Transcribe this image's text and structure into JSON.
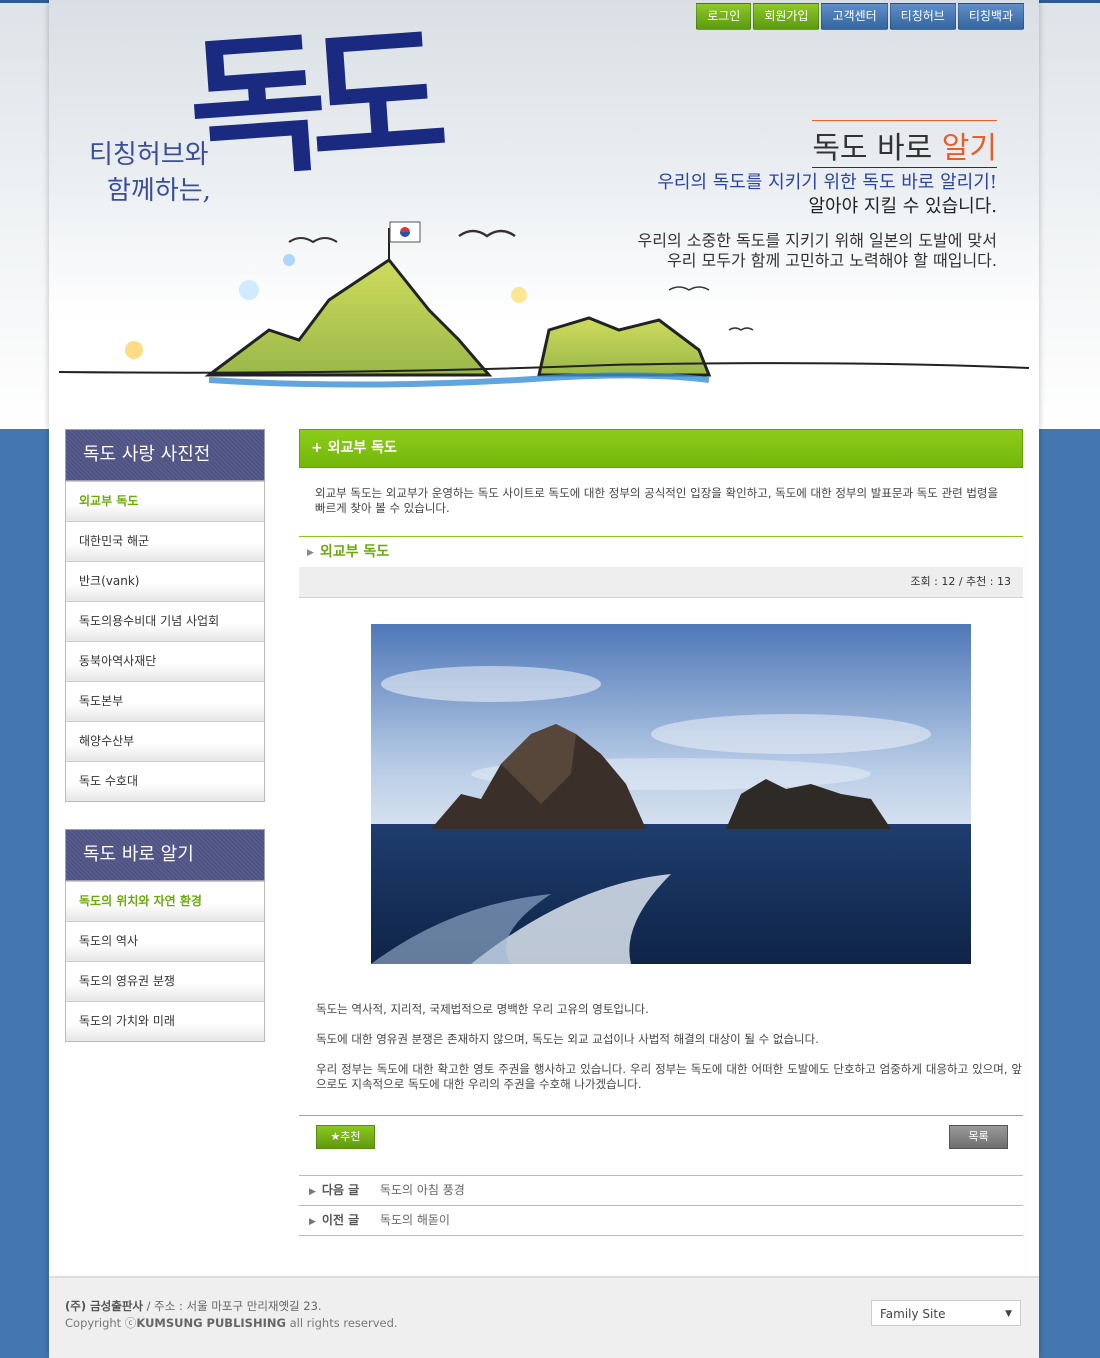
{
  "top_menu": [
    {
      "label": "로그인"
    },
    {
      "label": "회원가입"
    },
    {
      "label": "고객센터"
    },
    {
      "label": "티칭허브"
    },
    {
      "label": "티칭백과"
    }
  ],
  "header": {
    "logo_big": "독도",
    "logo_sub1": "티칭허브와",
    "logo_sub2": "함께하는,",
    "right_title_a": "독도 바로 ",
    "right_title_b": "알기",
    "line1": "우리의 독도를 지키기 위한 독도 바로 알리기!",
    "line2": "알아야 지킬 수 있습니다.",
    "line3": "우리의 소중한 독도를 지키기 위해 일본의 도발에 맞서",
    "line4": "우리 모두가 함께 고민하고 노력해야 할 때입니다."
  },
  "sidebar1": {
    "title": "독도 사랑 사진전",
    "items": [
      "외교부 독도",
      "대한민국 해군",
      "반크(vank)",
      "독도의용수비대 기념 사업회",
      "동북아역사재단",
      "독도본부",
      "해양수산부",
      "독도 수호대"
    ]
  },
  "sidebar2": {
    "title": "독도 바로 알기",
    "items": [
      "독도의 위치와 자연 환경",
      "독도의 역사",
      "독도의 영유권 분쟁",
      "독도의 가치와 미래"
    ]
  },
  "main": {
    "heading": "+ 외교부 독도",
    "intro": "외교부 독도는 외교부가 운영하는 독도 사이트로 독도에 대한 정부의 공식적인 입장을 확인하고, 독도에 대한 정부의 발표문과 독도 관련 법령을 빠르게 찾아 볼 수 있습니다.",
    "post_title": "외교부 독도",
    "meta": "조회 : 12 / 추천 : 13",
    "paragraphs": [
      "독도는 역사적, 지리적, 국제법적으로 명백한 우리 고유의 영토입니다.",
      "독도에 대한 영유권 분쟁은 존재하지 않으며, 독도는 외교 교섭이나 사법적 해결의 대상이 될 수 없습니다.",
      "우리 정부는 독도에 대한 확고한 영토 주권을 행사하고 있습니다. 우리 정부는 독도에 대한 어떠한 도발에도 단호하고 엄중하게 대응하고 있으며, 앞으로도 지속적으로 독도에 대한 우리의 주권을 수호해 나가겠습니다."
    ],
    "recommend_label": "★추천",
    "list_label": "목록",
    "next_label": "다음 글",
    "next_value": "독도의 아침 풍경",
    "prev_label": "이전 글",
    "prev_value": "독도의 해돋이"
  },
  "footer": {
    "company": "(주) 금성출판사",
    "address": " / 주소 : 서울 마포구 만리재옛길 23.",
    "copyright_a": "Copyright ⓒ",
    "copyright_b": "KUMSUNG PUBLISHING",
    "copyright_c": " all rights reserved.",
    "family_site": "Family Site"
  },
  "colors": {
    "green": "#80c110",
    "navy": "#4e5384",
    "blue_bg": "#4476b0"
  }
}
